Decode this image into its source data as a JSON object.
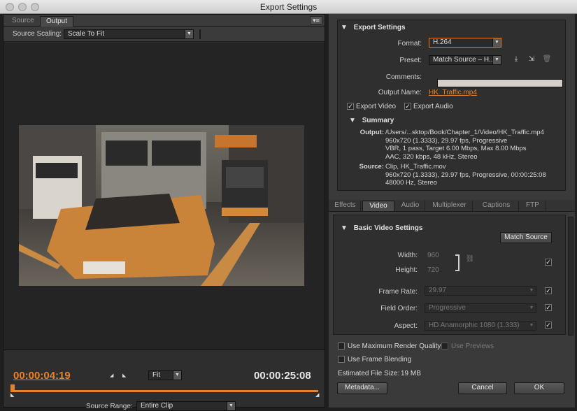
{
  "window": {
    "title": "Export Settings"
  },
  "left_panel": {
    "tabs": [
      {
        "label": "Source",
        "active": false
      },
      {
        "label": "Output",
        "active": true
      }
    ],
    "source_scaling": {
      "label": "Source Scaling:",
      "value": "Scale To Fit"
    },
    "current_time": "00:00:04:19",
    "duration": "00:00:25:08",
    "zoom": "Fit",
    "source_range": {
      "label": "Source Range:",
      "value": "Entire Clip"
    }
  },
  "export_settings": {
    "heading": "Export Settings",
    "format": {
      "label": "Format:",
      "value": "H.264"
    },
    "preset": {
      "label": "Preset:",
      "value": "Match Source – H..."
    },
    "comments": {
      "label": "Comments:",
      "value": ""
    },
    "output_name": {
      "label": "Output Name:",
      "value": "HK_Traffic.mp4"
    },
    "export_video": {
      "label": "Export Video",
      "checked": true
    },
    "export_audio": {
      "label": "Export Audio",
      "checked": true
    },
    "summary": {
      "heading": "Summary",
      "output_label": "Output:",
      "output_lines": [
        "/Users/...sktop/Book/Chapter_1/Video/HK_Traffic.mp4",
        "960x720 (1.3333), 29.97 fps, Progressive",
        "VBR, 1 pass, Target 6.00 Mbps, Max 8.00 Mbps",
        "AAC, 320 kbps, 48 kHz, Stereo"
      ],
      "source_label": "Source:",
      "source_lines": [
        "Clip, HK_Traffic.mov",
        "960x720 (1.3333), 29.97 fps, Progressive, 00:00:25:08",
        "48000 Hz, Stereo"
      ]
    }
  },
  "settings_tabs": [
    {
      "label": "Effects",
      "active": false
    },
    {
      "label": "Video",
      "active": true
    },
    {
      "label": "Audio",
      "active": false
    },
    {
      "label": "Multiplexer",
      "active": false
    },
    {
      "label": "Captions",
      "active": false
    },
    {
      "label": "FTP",
      "active": false
    }
  ],
  "basic_video": {
    "heading": "Basic Video Settings",
    "match_source": "Match Source",
    "width": {
      "label": "Width:",
      "value": "960"
    },
    "height": {
      "label": "Height:",
      "value": "720"
    },
    "frame_rate": {
      "label": "Frame Rate:",
      "value": "29.97"
    },
    "field_order": {
      "label": "Field Order:",
      "value": "Progressive"
    },
    "aspect": {
      "label": "Aspect:",
      "value": "HD Anamorphic 1080 (1.333)"
    }
  },
  "bottom": {
    "max_render_quality": "Use Maximum Render Quality",
    "use_previews": "Use Previews",
    "frame_blending": "Use Frame Blending",
    "file_size_label": "Estimated File Size:",
    "file_size_value": "19 MB",
    "metadata_button": "Metadata...",
    "cancel_button": "Cancel",
    "ok_button": "OK"
  },
  "colors": {
    "accent": "#e8822a",
    "panel": "#3a3a3a",
    "dark": "#2e2e2e"
  }
}
